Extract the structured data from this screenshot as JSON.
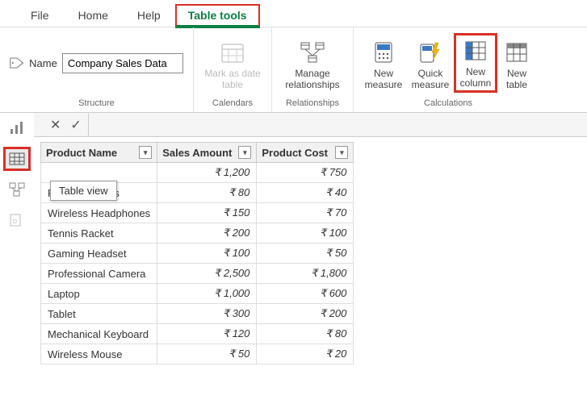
{
  "tabs": {
    "file": "File",
    "home": "Home",
    "help": "Help",
    "tabletools": "Table tools"
  },
  "ribbon": {
    "name_label": "Name",
    "name_value": "Company Sales Data",
    "structure": "Structure",
    "calendars": "Calendars",
    "mark_as_date": "Mark as date\ntable",
    "relationships_group": "Relationships",
    "manage_rel": "Manage\nrelationships",
    "calculations": "Calculations",
    "new_measure": "New\nmeasure",
    "quick_measure": "Quick\nmeasure",
    "new_column": "New\ncolumn",
    "new_table": "New\ntable"
  },
  "tooltip": "Table view",
  "columns": {
    "product": "Product Name",
    "sales": "Sales Amount",
    "cost": "Product Cost"
  },
  "rows": [
    {
      "product": "",
      "sales": "₹ 1,200",
      "cost": "₹ 750"
    },
    {
      "product": "Running Shoes",
      "sales": "₹ 80",
      "cost": "₹ 40"
    },
    {
      "product": "Wireless Headphones",
      "sales": "₹ 150",
      "cost": "₹ 70"
    },
    {
      "product": "Tennis Racket",
      "sales": "₹ 200",
      "cost": "₹ 100"
    },
    {
      "product": "Gaming Headset",
      "sales": "₹ 100",
      "cost": "₹ 50"
    },
    {
      "product": "Professional Camera",
      "sales": "₹ 2,500",
      "cost": "₹ 1,800"
    },
    {
      "product": "Laptop",
      "sales": "₹ 1,000",
      "cost": "₹ 600"
    },
    {
      "product": "Tablet",
      "sales": "₹ 300",
      "cost": "₹ 200"
    },
    {
      "product": "Mechanical Keyboard",
      "sales": "₹ 120",
      "cost": "₹ 80"
    },
    {
      "product": "Wireless Mouse",
      "sales": "₹ 50",
      "cost": "₹ 20"
    }
  ]
}
